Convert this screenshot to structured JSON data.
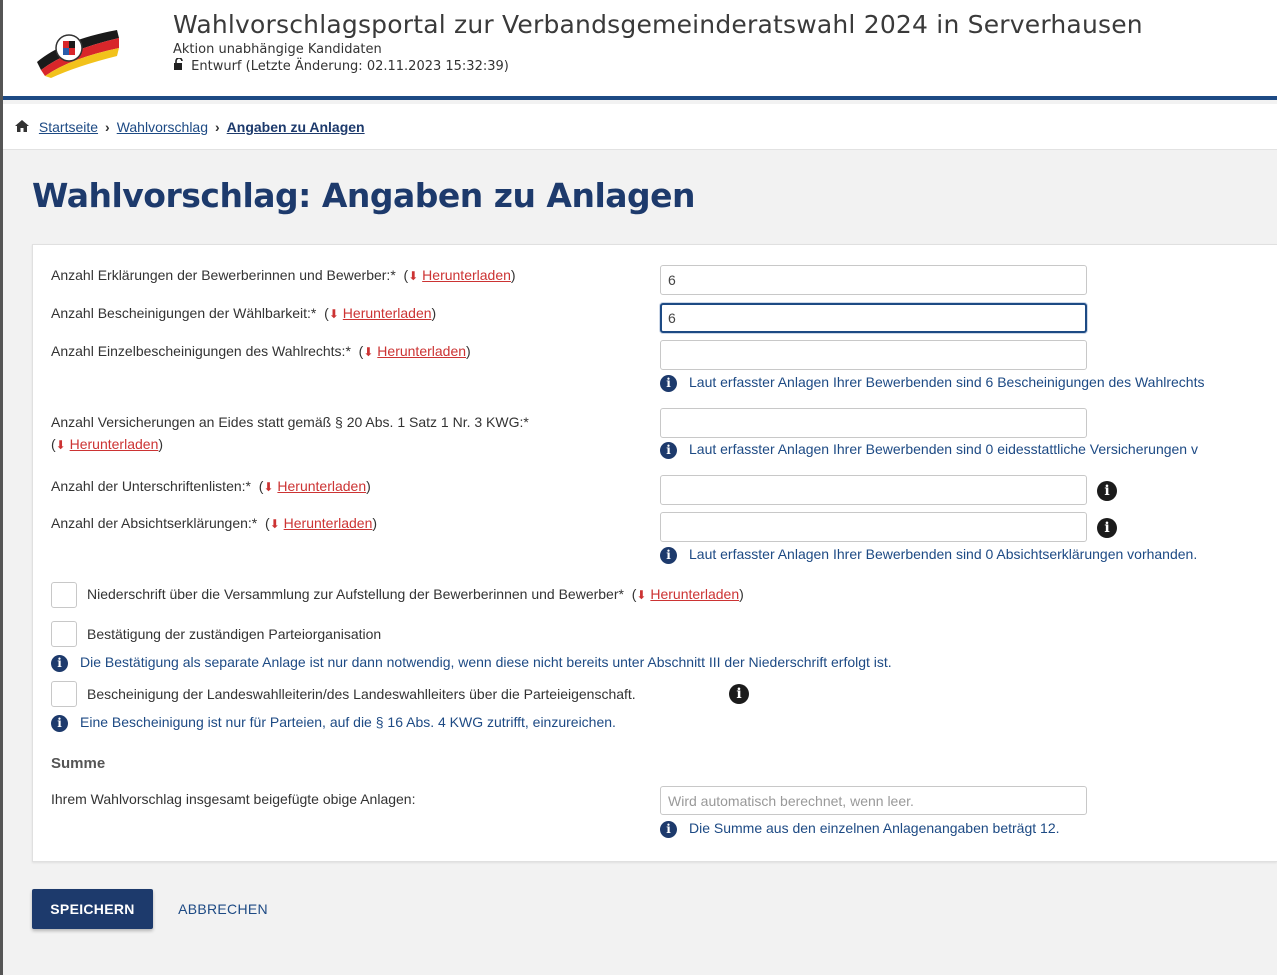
{
  "header": {
    "title": "Wahlvorschlagsportal zur Verbandsgemeinderatswahl 2024 in Serverhausen",
    "subtitle": "Aktion unabhängige Kandidaten",
    "status": "Entwurf (Letzte Änderung: 02.11.2023 15:32:39)",
    "lock_icon": "unlock-icon"
  },
  "breadcrumb": {
    "home": "Startseite",
    "level1": "Wahlvorschlag",
    "current": "Angaben zu Anlagen"
  },
  "page_title": "Wahlvorschlag: Angaben zu Anlagen",
  "download_label": "Herunterladen",
  "fields": {
    "erklaerungen": {
      "label": "Anzahl Erklärungen der Bewerberinnen und Bewerber:*",
      "value": "6"
    },
    "bescheinigungen": {
      "label": "Anzahl Bescheinigungen der Wählbarkeit:*",
      "value": "6"
    },
    "einzelbescheinigungen": {
      "label": "Anzahl Einzelbescheinigungen des Wahlrechts:*",
      "value": "",
      "hint": "Laut erfasster Anlagen Ihrer Bewerbenden sind 6 Bescheinigungen des Wahlrechts"
    },
    "versicherungen": {
      "label": "Anzahl Versicherungen an Eides statt gemäß § 20 Abs. 1 Satz 1 Nr. 3 KWG:*",
      "value": "",
      "hint": "Laut erfasster Anlagen Ihrer Bewerbenden sind 0 eidesstattliche Versicherungen v"
    },
    "unterschriftenlisten": {
      "label": "Anzahl der Unterschriftenlisten:*",
      "value": ""
    },
    "absichtserklaerungen": {
      "label": "Anzahl der Absichtserklärungen:*",
      "value": "",
      "hint": "Laut erfasster Anlagen Ihrer Bewerbenden sind 0 Absichtserklärungen vorhanden."
    }
  },
  "checkboxes": {
    "niederschrift": {
      "label": "Niederschrift über die Versammlung zur Aufstellung der Bewerberinnen und Bewerber*",
      "checked": false
    },
    "bestaetigung": {
      "label": "Bestätigung der zuständigen Parteiorganisation",
      "checked": false,
      "hint": "Die Bestätigung als separate Anlage ist nur dann notwendig, wenn diese nicht bereits unter Abschnitt III der Niederschrift erfolgt ist."
    },
    "landeswahlleiter": {
      "label": "Bescheinigung der Landeswahlleiterin/des Landeswahlleiters über die Parteieigenschaft.",
      "checked": false,
      "hint": "Eine Bescheinigung ist nur für Parteien, auf die § 16 Abs. 4 KWG zutrifft, einzureichen."
    }
  },
  "summe": {
    "heading": "Summe",
    "label": "Ihrem Wahlvorschlag insgesamt beigefügte obige Anlagen:",
    "placeholder": "Wird automatisch berechnet, wenn leer.",
    "hint": "Die Summe aus den einzelnen Anlagenangaben beträgt 12."
  },
  "buttons": {
    "save": "SPEICHERN",
    "cancel": "ABBRECHEN"
  },
  "colors": {
    "primary": "#1d3a6c",
    "link": "#1d4a84",
    "download": "#cc3333"
  }
}
